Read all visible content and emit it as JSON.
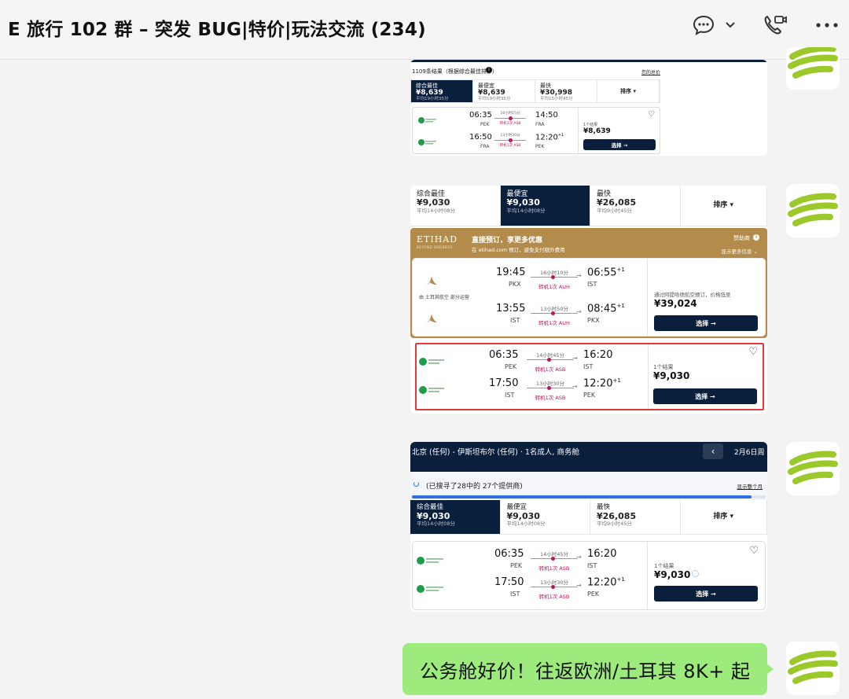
{
  "header": {
    "title": "E 旅行 102 群 – 突发 BUG|特价|玩法交流 (234)",
    "icons": [
      "chat-bubble-icon",
      "chevron-down-icon",
      "video-call-icon",
      "more-icon"
    ]
  },
  "avatar": {
    "icon": "green-stripes-logo-icon",
    "color": "#9bc92b"
  },
  "shot1": {
    "header": "1109条结果（根据综合最佳排序）",
    "header_right": "您的总价",
    "tabs": [
      {
        "label": "综合最佳",
        "price": "¥8,639",
        "sub": "平均19小时35分"
      },
      {
        "label": "最便宜",
        "price": "¥8,639",
        "sub": "平均19小时35分"
      },
      {
        "label": "最快",
        "price": "¥30,998",
        "sub": "平均15小时45分"
      },
      {
        "label": "排序"
      }
    ],
    "result": {
      "legs": [
        {
          "dep": "06:35",
          "dep_code": "PEK",
          "dur": "16小时15分",
          "stop": "转机1次 ASB",
          "arr": "14:50",
          "arr_code": "FRA"
        },
        {
          "dep": "16:50",
          "dep_code": "FRA",
          "dur": "13小时30分",
          "stop": "转机1次 ASB",
          "arr": "12:20",
          "arr_plus": "+1",
          "arr_code": "PEK"
        }
      ],
      "count": "1个结果",
      "price": "¥8,639",
      "button": "选择 →"
    }
  },
  "shot2": {
    "tabs": [
      {
        "label": "综合最佳",
        "price": "¥9,030",
        "sub": "平均14小时08分"
      },
      {
        "label": "最便宜",
        "price": "¥9,030",
        "sub": "平均14小时08分"
      },
      {
        "label": "最快",
        "price": "¥26,085",
        "sub": "平均9小时45分"
      },
      {
        "label": "排序"
      }
    ],
    "ad": {
      "brand": "ETIHAD",
      "brand_sub": "BEYOND BORDERS",
      "headline": "直接预订，享更多优惠",
      "subline": "在 etihad.com 预订，避免支付额外费用",
      "sponsor": "赞助商",
      "more": "显示更多信息",
      "operated": "由 土耳其航空 部分运营",
      "legs": [
        {
          "dep": "19:45",
          "dep_code": "PKX",
          "dur": "16小时10分",
          "stop": "转机1次 AUH",
          "arr": "06:55",
          "arr_plus": "+1",
          "arr_code": "IST"
        },
        {
          "dep": "13:55",
          "dep_code": "IST",
          "dur": "13小时50分",
          "stop": "转机1次 AUH",
          "arr": "08:45",
          "arr_plus": "+1",
          "arr_code": "PKX"
        }
      ],
      "note": "通过阿提哈德航空预订，价格低至",
      "price": "¥39,024",
      "button": "选择 →"
    },
    "result": {
      "legs": [
        {
          "dep": "06:35",
          "dep_code": "PEK",
          "dur": "14小时45分",
          "stop": "转机1次 ASB",
          "arr": "16:20",
          "arr_code": "IST"
        },
        {
          "dep": "17:50",
          "dep_code": "IST",
          "dur": "13小时30分",
          "stop": "转机1次 ASB",
          "arr": "12:20",
          "arr_plus": "+1",
          "arr_code": "PEK"
        }
      ],
      "count": "1个结果",
      "price": "¥9,030",
      "button": "选择 →"
    }
  },
  "shot3": {
    "route": "北京 (任何) - 伊斯坦布尔 (任何) · 1名成人, 商务舱",
    "date": "2月6日周",
    "progress_text": "(已搜寻了28中的 27个提供商)",
    "progress_right": "显示整个月",
    "progress": 0.96,
    "tabs": [
      {
        "label": "综合最佳",
        "price": "¥9,030",
        "sub": "平均14小时08分"
      },
      {
        "label": "最便宜",
        "price": "¥9,030",
        "sub": "平均14小时08分"
      },
      {
        "label": "最快",
        "price": "¥26,085",
        "sub": "平均9小时45分"
      },
      {
        "label": "排序"
      }
    ],
    "result": {
      "legs": [
        {
          "dep": "06:35",
          "dep_code": "PEK",
          "dur": "14小时45分",
          "stop": "转机1次 ASB",
          "arr": "16:20",
          "arr_code": "IST"
        },
        {
          "dep": "17:50",
          "dep_code": "IST",
          "dur": "13小时30分",
          "stop": "转机1次 ASB",
          "arr": "12:20",
          "arr_plus": "+1",
          "arr_code": "PEK"
        }
      ],
      "count": "1个结果",
      "price": "¥9,030",
      "button": "选择 →"
    }
  },
  "message": {
    "text": "公务舱好价！往返欧洲/土耳其 8K+ 起",
    "bubble_color": "#9deb7c"
  },
  "colors": {
    "navy": "#0a1f3c",
    "etihad_gold": "#b38b4a",
    "stop_red": "#c0135e",
    "highlight_border": "#e03a3a"
  }
}
